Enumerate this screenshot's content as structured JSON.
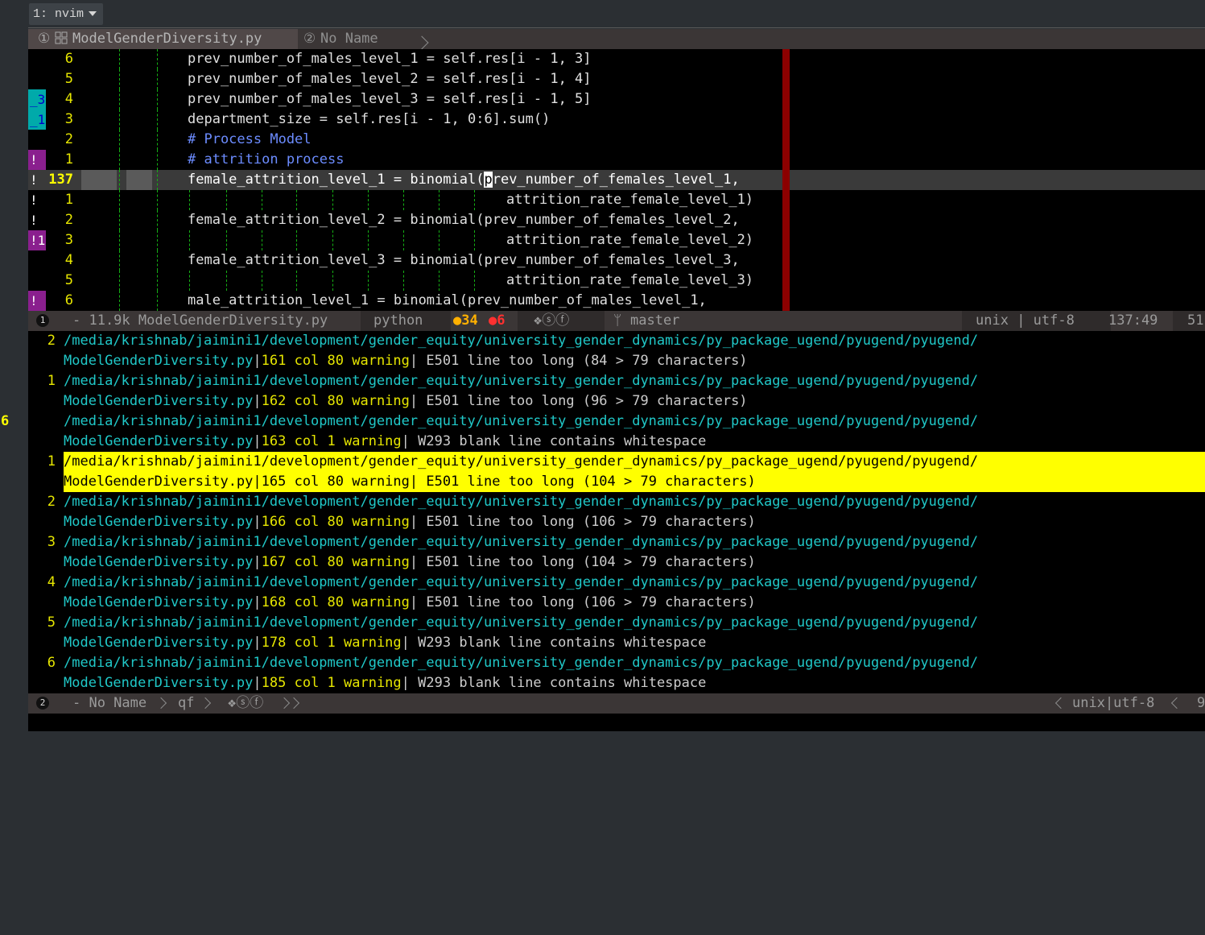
{
  "tmux": {
    "tab_label": "1: nvim"
  },
  "bufferline": {
    "active": {
      "index": "①",
      "name": "ModelGenderDiversity.py"
    },
    "inactive": {
      "index": "②",
      "name": "No Name"
    }
  },
  "editor": {
    "rows": [
      {
        "sign": "",
        "sign_color": "",
        "num": "6",
        "code": "prev_number_of_males_level_1 = self.res[i - 1, 3]",
        "comment": false
      },
      {
        "sign": "",
        "sign_color": "",
        "num": "5",
        "code": "prev_number_of_males_level_2 = self.res[i - 1, 4]",
        "comment": false
      },
      {
        "sign": "_3",
        "sign_color": "blue",
        "num": "4",
        "code": "prev_number_of_males_level_3 = self.res[i - 1, 5]",
        "comment": false
      },
      {
        "sign": "_1",
        "sign_color": "blue",
        "num": "3",
        "code": "department_size = self.res[i - 1, 0:6].sum()",
        "comment": false
      },
      {
        "sign": "",
        "sign_color": "",
        "num": "2",
        "code": "# Process Model",
        "comment": true
      },
      {
        "sign": "!",
        "sign_color": "purple",
        "num": "1",
        "code": "# attrition process",
        "comment": true
      },
      {
        "sign": "!",
        "sign_color": "",
        "num": "137",
        "code_before_cursor": "female_attrition_level_1 = binomial(",
        "cursor_char": "p",
        "code_after_cursor": "rev_number_of_females_level_1,",
        "current": true
      },
      {
        "sign": "!",
        "sign_color": "",
        "num": "1",
        "code": "attrition_rate_female_level_1)",
        "continuation": true
      },
      {
        "sign": "!",
        "sign_color": "",
        "num": "2",
        "code": "female_attrition_level_2 = binomial(prev_number_of_females_level_2,",
        "comment": false
      },
      {
        "sign": "!1",
        "sign_color": "purple",
        "num": "3",
        "code": "attrition_rate_female_level_2)",
        "continuation": true
      },
      {
        "sign": "",
        "sign_color": "",
        "num": "4",
        "code": "female_attrition_level_3 = binomial(prev_number_of_females_level_3,",
        "comment": false
      },
      {
        "sign": "",
        "sign_color": "",
        "num": "5",
        "code": "attrition_rate_female_level_3)",
        "continuation": true
      },
      {
        "sign": "!",
        "sign_color": "purple",
        "num": "6",
        "code": "male_attrition_level_1 = binomial(prev_number_of_males_level_1,",
        "comment": false
      }
    ]
  },
  "status1": {
    "window_num": "1",
    "file_info": "- 11.9k ModelGenderDiversity.py",
    "filetype": "python",
    "warnings": "●34",
    "errors": "●6",
    "icons": "❖ⓢⓕ",
    "branch_icon": "ᛘ",
    "branch": "master",
    "fileformat": "unix",
    "encoding": "utf-8",
    "position": "137:49",
    "percent": "51",
    "colors": {
      "warnings": "#ffb000",
      "errors": "#ff3030"
    }
  },
  "quickfix": {
    "rows": [
      {
        "num": "2",
        "path": "/media/krishnab/jaimini1/development/gender_equity/university_gender_dynamics/py_package_ugend/pyugend/pyugend/",
        "file": "ModelGenderDiversity.py",
        "loc": "161 col 80 warning",
        "msg": " E501 line too long (84 > 79 characters)"
      },
      {
        "num": "1",
        "path": "/media/krishnab/jaimini1/development/gender_equity/university_gender_dynamics/py_package_ugend/pyugend/pyugend/",
        "file": "ModelGenderDiversity.py",
        "loc": "162 col 80 warning",
        "msg": " E501 line too long (96 > 79 characters)"
      },
      {
        "num": "6",
        "num_left": true,
        "path": "/media/krishnab/jaimini1/development/gender_equity/university_gender_dynamics/py_package_ugend/pyugend/pyugend/",
        "file": "ModelGenderDiversity.py",
        "loc": "163 col 1 warning",
        "msg": " W293 blank line contains whitespace"
      },
      {
        "num": "1",
        "selected": true,
        "path": "/media/krishnab/jaimini1/development/gender_equity/university_gender_dynamics/py_package_ugend/pyugend/pyugend/",
        "file": "ModelGenderDiversity.py",
        "loc": "165 col 80 warning",
        "msg": " E501 line too long (104 > 79 characters)"
      },
      {
        "num": "2",
        "path": "/media/krishnab/jaimini1/development/gender_equity/university_gender_dynamics/py_package_ugend/pyugend/pyugend/",
        "file": "ModelGenderDiversity.py",
        "loc": "166 col 80 warning",
        "msg": " E501 line too long (106 > 79 characters)"
      },
      {
        "num": "3",
        "path": "/media/krishnab/jaimini1/development/gender_equity/university_gender_dynamics/py_package_ugend/pyugend/pyugend/",
        "file": "ModelGenderDiversity.py",
        "loc": "167 col 80 warning",
        "msg": " E501 line too long (104 > 79 characters)"
      },
      {
        "num": "4",
        "path": "/media/krishnab/jaimini1/development/gender_equity/university_gender_dynamics/py_package_ugend/pyugend/pyugend/",
        "file": "ModelGenderDiversity.py",
        "loc": "168 col 80 warning",
        "msg": " E501 line too long (106 > 79 characters)"
      },
      {
        "num": "5",
        "path": "/media/krishnab/jaimini1/development/gender_equity/university_gender_dynamics/py_package_ugend/pyugend/pyugend/",
        "file": "ModelGenderDiversity.py",
        "loc": "178 col 1 warning",
        "msg": " W293 blank line contains whitespace"
      },
      {
        "num": "6",
        "path": "/media/krishnab/jaimini1/development/gender_equity/university_gender_dynamics/py_package_ugend/pyugend/pyugend/",
        "file": "ModelGenderDiversity.py",
        "loc": "185 col 1 warning",
        "msg": " W293 blank line contains whitespace"
      }
    ]
  },
  "status2": {
    "window_num": "2",
    "name": "- No Name",
    "filetype": "qf",
    "icons": "❖ⓢⓕ",
    "format": "unix|utf-8",
    "percent": "9"
  }
}
